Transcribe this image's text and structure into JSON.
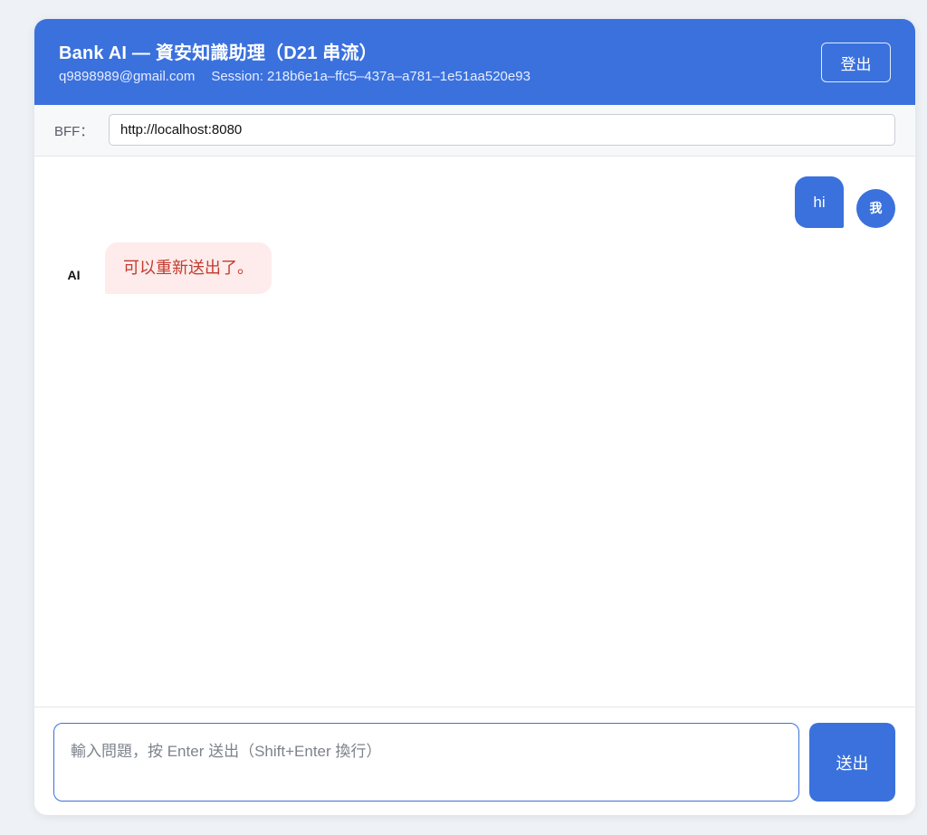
{
  "header": {
    "title": "Bank AI — 資安知識助理（D21 串流）",
    "email": "q9898989@gmail.com",
    "session_label": "Session:",
    "session_id": "218b6e1a–ffc5–437a–a781–1e51aa520e93",
    "logout_label": "登出"
  },
  "bff": {
    "label": "BFF：",
    "value": "http://localhost:8080"
  },
  "messages": [
    {
      "role": "user",
      "avatar": "我",
      "text": "hi"
    },
    {
      "role": "ai",
      "avatar": "AI",
      "text": "可以重新送出了。"
    }
  ],
  "composer": {
    "placeholder": "輸入問題，按 Enter 送出（Shift+Enter 換行）",
    "send_label": "送出"
  },
  "colors": {
    "primary": "#3a71dd",
    "error_bg": "#fdeceb",
    "error_text": "#c33b2f",
    "page_bg": "#eef1f5"
  }
}
